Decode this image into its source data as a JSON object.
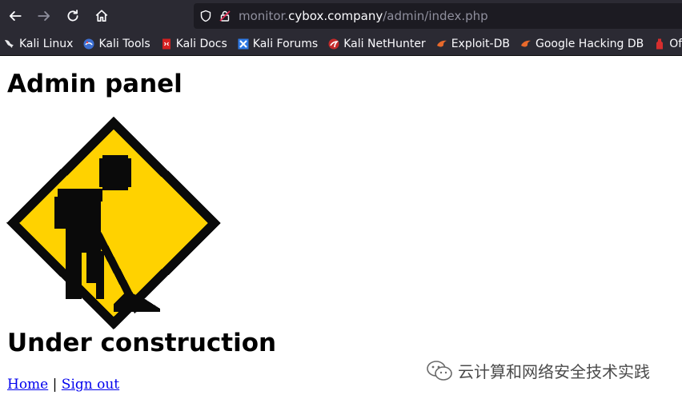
{
  "browser": {
    "url_prefix": "monitor.",
    "url_host": "cybox.company",
    "url_path": "/admin/index.php"
  },
  "bookmarks": [
    {
      "label": "Kali Linux",
      "icon": "kali-dragon-icon"
    },
    {
      "label": "Kali Tools",
      "icon": "kali-tools-icon"
    },
    {
      "label": "Kali Docs",
      "icon": "kali-docs-icon"
    },
    {
      "label": "Kali Forums",
      "icon": "kali-forums-icon"
    },
    {
      "label": "Kali NetHunter",
      "icon": "kali-nethunter-icon"
    },
    {
      "label": "Exploit-DB",
      "icon": "exploit-db-icon"
    },
    {
      "label": "Google Hacking DB",
      "icon": "ghdb-icon"
    },
    {
      "label": "OffSec",
      "icon": "offsec-icon"
    }
  ],
  "page": {
    "heading": "Admin panel",
    "subheading": "Under construction",
    "link_home": "Home",
    "separator": "|",
    "link_signout": "Sign out"
  },
  "watermark": {
    "text": "云计算和网络安全技术实践"
  },
  "colors": {
    "sign_yellow": "#ffd200",
    "link_blue": "#0000ee",
    "toolbar_bg": "#2b2a33"
  }
}
